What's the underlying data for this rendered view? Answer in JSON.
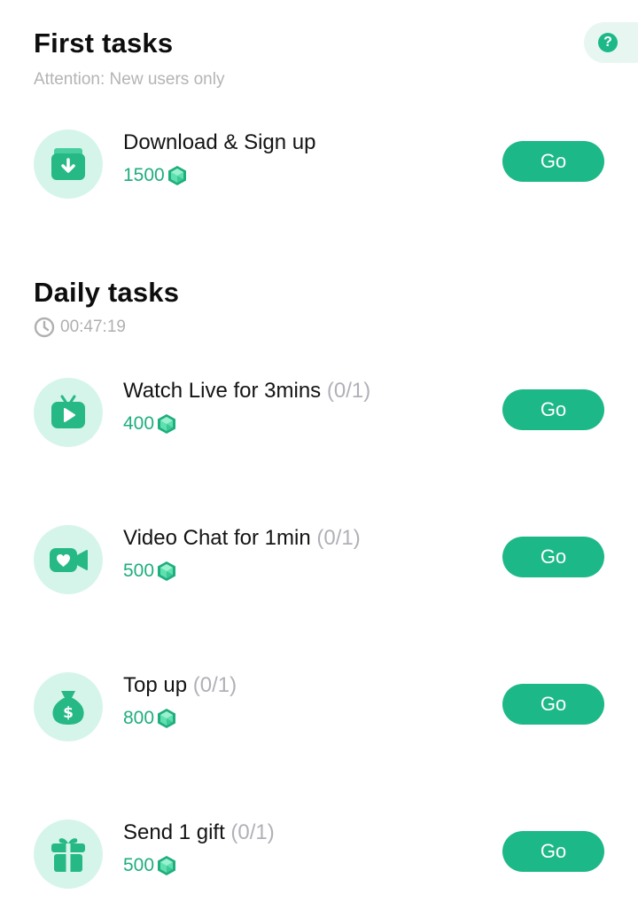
{
  "first_tasks": {
    "title": "First tasks",
    "subtitle": "Attention: New users only",
    "items": [
      {
        "label": "Download & Sign up",
        "progress": "",
        "reward": "1500",
        "icon": "download-icon",
        "button": "Go"
      }
    ]
  },
  "daily_tasks": {
    "title": "Daily tasks",
    "timer": "00:47:19",
    "items": [
      {
        "label": "Watch Live for 3mins",
        "progress": "(0/1)",
        "reward": "400",
        "icon": "live-tv-icon",
        "button": "Go"
      },
      {
        "label": "Video Chat for 1min",
        "progress": "(0/1)",
        "reward": "500",
        "icon": "video-chat-icon",
        "button": "Go"
      },
      {
        "label": "Top up",
        "progress": "(0/1)",
        "reward": "800",
        "icon": "money-bag-icon",
        "button": "Go"
      },
      {
        "label": "Send 1 gift",
        "progress": "(0/1)",
        "reward": "500",
        "icon": "gift-icon",
        "button": "Go"
      }
    ]
  },
  "help": {
    "icon": "help-icon",
    "glyph": "?"
  },
  "colors": {
    "accent": "#1db887",
    "icon_bg": "#d6f5ea",
    "reward_text": "#1fae7e",
    "muted_text": "#b0b0b0",
    "gem": "#2ec28f"
  }
}
